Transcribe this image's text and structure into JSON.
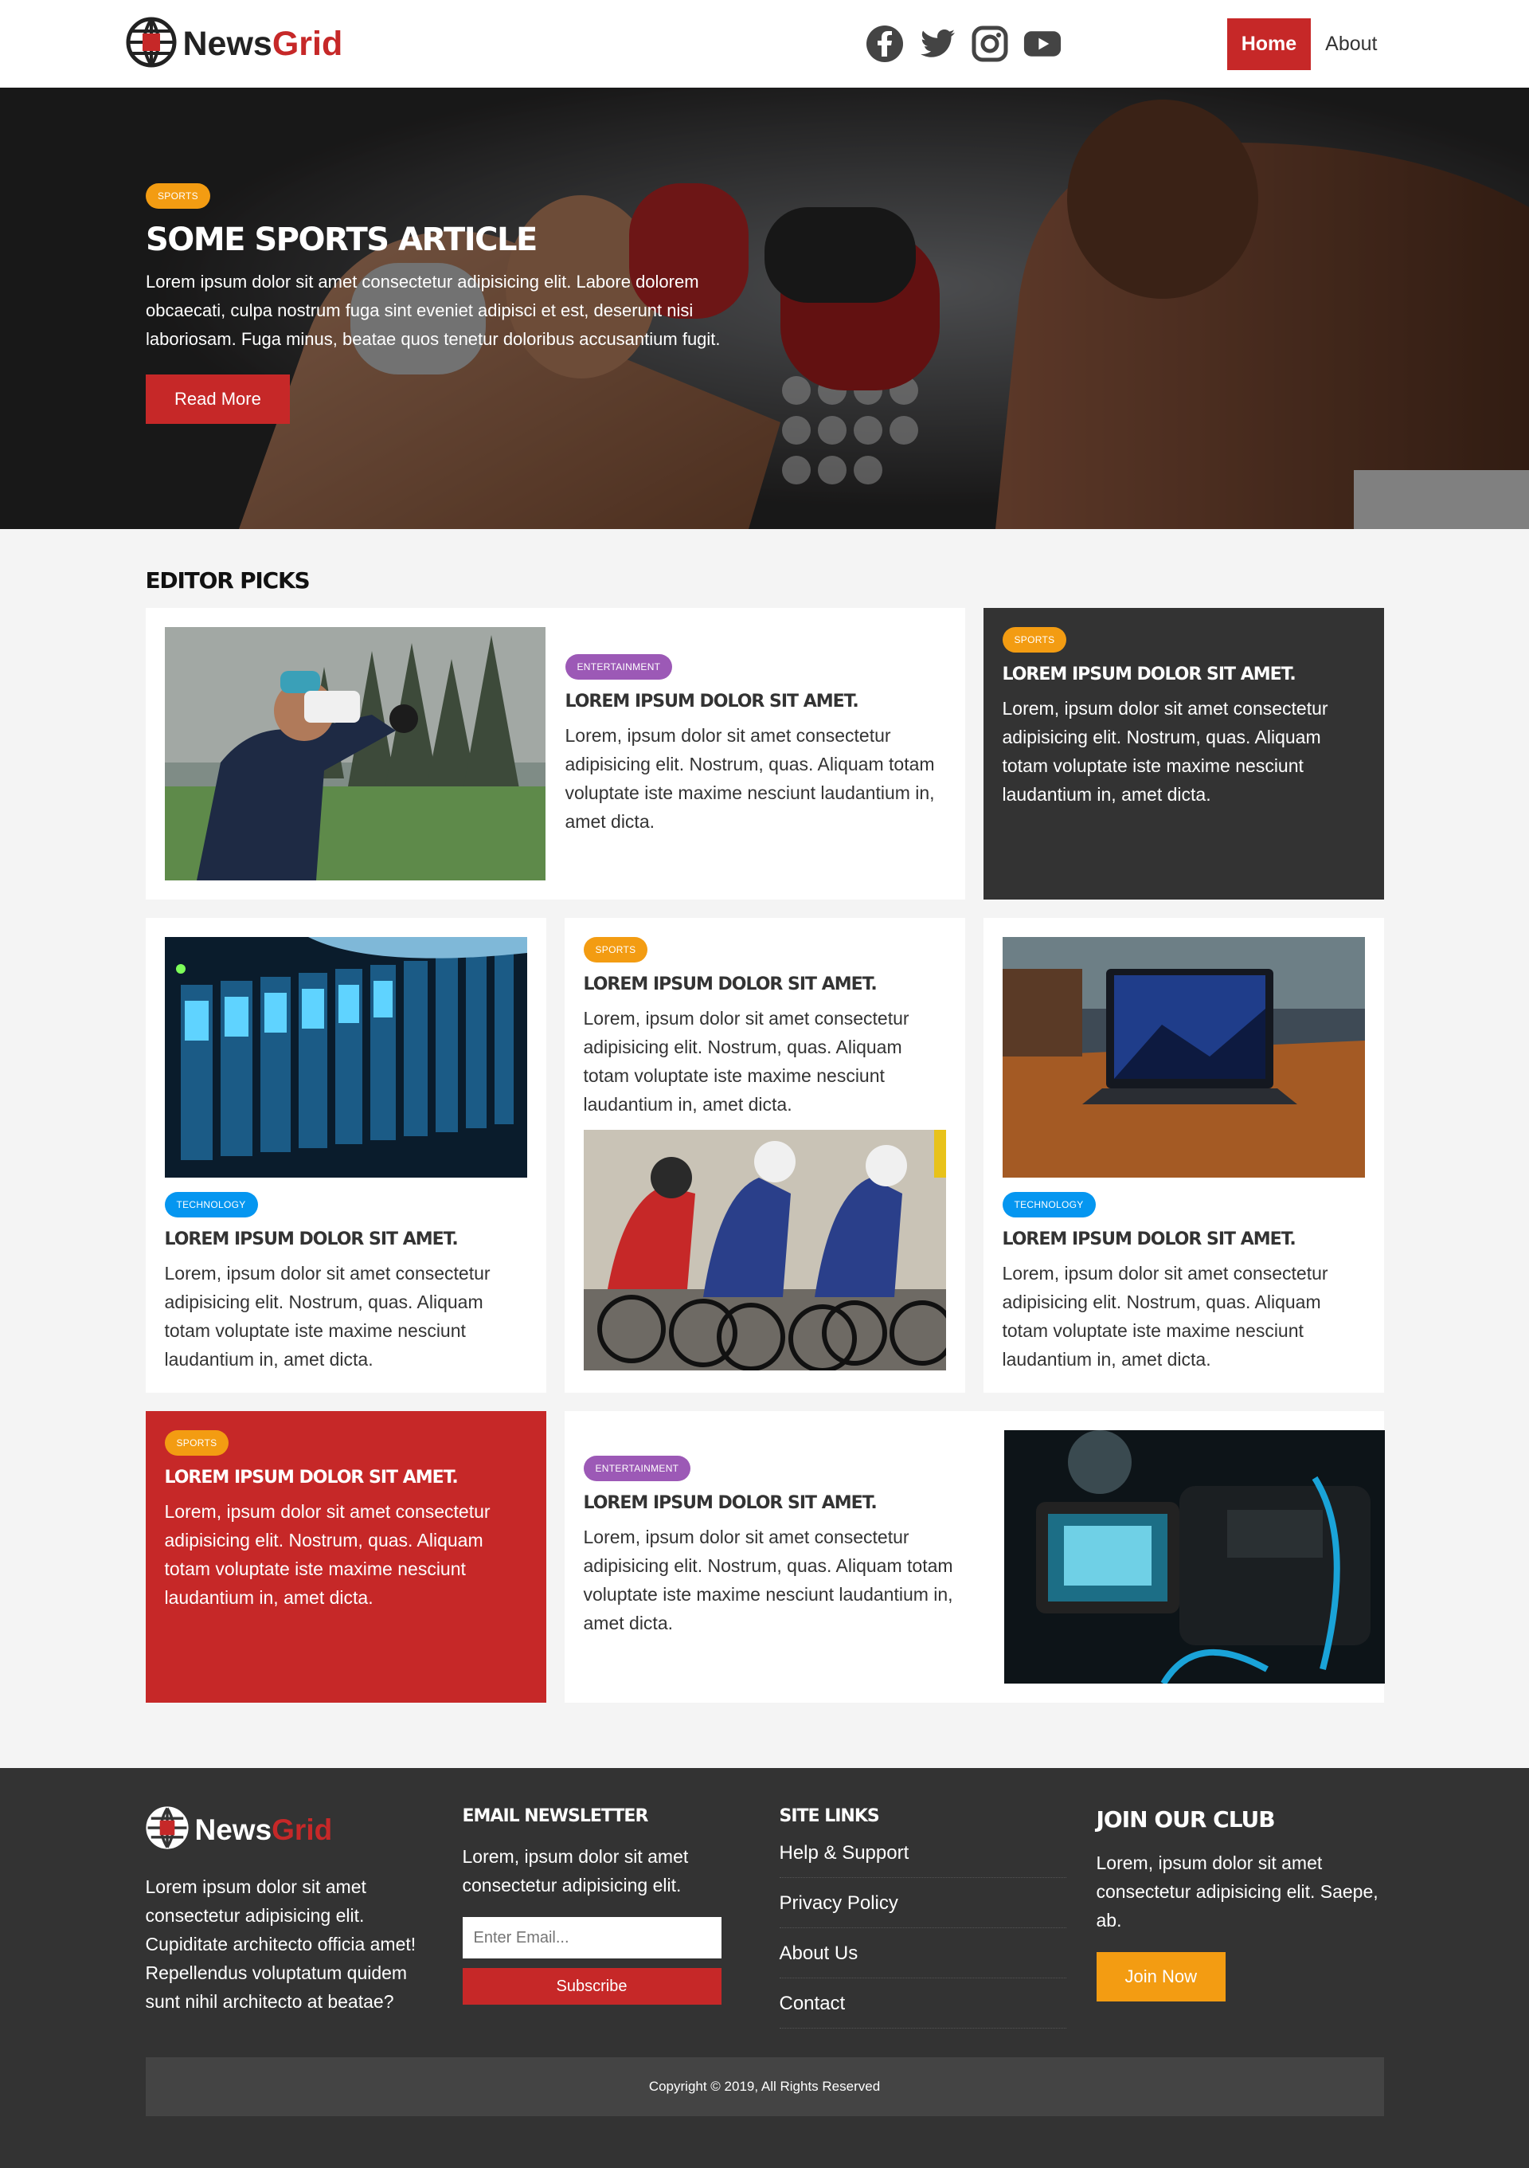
{
  "brand": {
    "logo_main": "News",
    "logo_accent": "Grid"
  },
  "nav": {
    "social": [
      "facebook-icon",
      "twitter-icon",
      "instagram-icon",
      "youtube-icon"
    ],
    "links": [
      {
        "label": "Home",
        "active": true
      },
      {
        "label": "About",
        "active": false
      }
    ]
  },
  "hero": {
    "category": "Sports",
    "title": "Some Sports Article",
    "text": "Lorem ipsum dolor sit amet consectetur adipisicing elit. Labore dolorem obcaecati, culpa nostrum fuga sint eveniet adipisci et est, deserunt nisi laboriosam. Fuga minus, beatae quos tenetur doloribus accusantium fugit.",
    "button": "Read More"
  },
  "editor_picks": {
    "title": "Editor Picks",
    "cards": [
      {
        "category": "Entertainment",
        "title": "Lorem ipsum dolor sit amet.",
        "text": "Lorem, ipsum dolor sit amet consectetur adipisicing elit. Nostrum, quas. Aliquam totam voluptate iste maxime nesciunt laudantium in, amet dicta."
      },
      {
        "category": "Sports",
        "title": "Lorem ipsum dolor sit amet.",
        "text": "Lorem, ipsum dolor sit amet consectetur adipisicing elit. Nostrum, quas. Aliquam totam voluptate iste maxime nesciunt laudantium in, amet dicta."
      },
      {
        "category": "Technology",
        "title": "Lorem ipsum dolor sit amet.",
        "text": "Lorem, ipsum dolor sit amet consectetur adipisicing elit. Nostrum, quas. Aliquam totam voluptate iste maxime nesciunt laudantium in, amet dicta."
      },
      {
        "category": "Sports",
        "title": "Lorem ipsum dolor sit amet.",
        "text": "Lorem, ipsum dolor sit amet consectetur adipisicing elit. Nostrum, quas. Aliquam totam voluptate iste maxime nesciunt laudantium in, amet dicta."
      },
      {
        "category": "Technology",
        "title": "Lorem ipsum dolor sit amet.",
        "text": "Lorem, ipsum dolor sit amet consectetur adipisicing elit. Nostrum, quas. Aliquam totam voluptate iste maxime nesciunt laudantium in, amet dicta."
      },
      {
        "category": "Sports",
        "title": "Lorem ipsum dolor sit amet.",
        "text": "Lorem, ipsum dolor sit amet consectetur adipisicing elit. Nostrum, quas. Aliquam totam voluptate iste maxime nesciunt laudantium in, amet dicta."
      },
      {
        "category": "Entertainment",
        "title": "Lorem ipsum dolor sit amet.",
        "text": "Lorem, ipsum dolor sit amet consectetur adipisicing elit. Nostrum, quas. Aliquam totam voluptate iste maxime nesciunt laudantium in, amet dicta."
      }
    ]
  },
  "footer": {
    "about_text": "Lorem ipsum dolor sit amet consectetur adipisicing elit. Cupiditate architecto officia amet! Repellendus voluptatum quidem sunt nihil architecto at beatae?",
    "newsletter": {
      "title": "Email Newsletter",
      "text": "Lorem, ipsum dolor sit amet consectetur adipisicing elit.",
      "placeholder": "Enter Email...",
      "button": "Subscribe"
    },
    "site_links": {
      "title": "Site Links",
      "items": [
        "Help & Support",
        "Privacy Policy",
        "About Us",
        "Contact"
      ]
    },
    "club": {
      "title": "Join Our Club",
      "text": "Lorem, ipsum dolor sit amet consectetur adipisicing elit. Saepe, ab.",
      "button": "Join Now"
    },
    "copyright": "Copyright © 2019, All Rights Reserved"
  },
  "colors": {
    "brand_red": "#c62828",
    "sports_orange": "#f39c12",
    "technology_blue": "#0596f0",
    "entertainment_purple": "#9c59b6",
    "dark": "#333333"
  }
}
